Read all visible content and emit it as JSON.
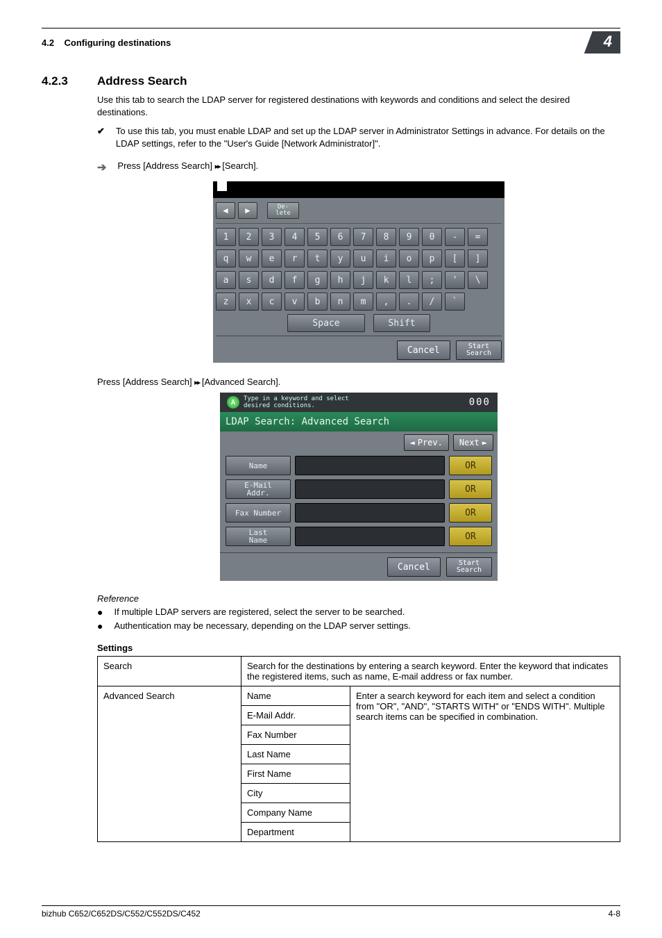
{
  "header": {
    "section_ref": "4.2",
    "section_title": "Configuring destinations",
    "chapter": "4"
  },
  "section": {
    "number": "4.2.3",
    "title": "Address Search"
  },
  "intro": "Use this tab to search the LDAP server for registered destinations with keywords and conditions and select the desired destinations.",
  "checklist": [
    "To use this tab, you must enable LDAP and set up the LDAP server in Administrator Settings in advance. For details on the LDAP settings, refer to the \"User's Guide [Network Administrator]\"."
  ],
  "step1": {
    "prefix": "Press [Address Search] ",
    "arrows": "▸▸",
    "suffix": " [Search]."
  },
  "kb": {
    "delete": "De-\nlete",
    "rows": [
      [
        "1",
        "2",
        "3",
        "4",
        "5",
        "6",
        "7",
        "8",
        "9",
        "0",
        "-",
        "="
      ],
      [
        "q",
        "w",
        "e",
        "r",
        "t",
        "y",
        "u",
        "i",
        "o",
        "p",
        "[",
        "]"
      ],
      [
        "a",
        "s",
        "d",
        "f",
        "g",
        "h",
        "j",
        "k",
        "l",
        ";",
        "'",
        "\\"
      ],
      [
        "z",
        "x",
        "c",
        "v",
        "b",
        "n",
        "m",
        ",",
        ".",
        "/",
        "`"
      ]
    ],
    "space": "Space",
    "shift": "Shift",
    "cancel": "Cancel",
    "start": "Start\nSearch"
  },
  "step2": {
    "prefix": "Press [Address Search] ",
    "arrows": "▸▸",
    "suffix": " [Advanced Search]."
  },
  "adv": {
    "top_hint": "Type in a keyword and select\ndesired conditions.",
    "count": "000",
    "title": "LDAP Search: Advanced Search",
    "prev": "Prev.",
    "next": "Next",
    "rows": [
      "Name",
      "E-Mail\nAddr.",
      "Fax Number",
      "Last\nName"
    ],
    "or": "OR",
    "cancel": "Cancel",
    "start": "Start\nSearch"
  },
  "reference": {
    "heading": "Reference",
    "items": [
      "If multiple LDAP servers are registered, select the server to be searched.",
      "Authentication may be necessary, depending on the LDAP server settings."
    ]
  },
  "settings": {
    "heading": "Settings",
    "search_label": "Search",
    "search_desc": "Search for the destinations by entering a search keyword. Enter the keyword that indicates the registered items, such as name, E-mail address or fax number.",
    "advanced_label": "Advanced Search",
    "advanced_desc": "Enter a search keyword for each item and select a condition from \"OR\", \"AND\", \"STARTS WITH\" or \"ENDS WITH\". Multiple search items can be specified in combination.",
    "advanced_items": [
      "Name",
      "E-Mail Addr.",
      "Fax Number",
      "Last Name",
      "First Name",
      "City",
      "Company Name",
      "Department"
    ]
  },
  "footer": {
    "left": "bizhub C652/C652DS/C552/C552DS/C452",
    "right": "4-8"
  }
}
